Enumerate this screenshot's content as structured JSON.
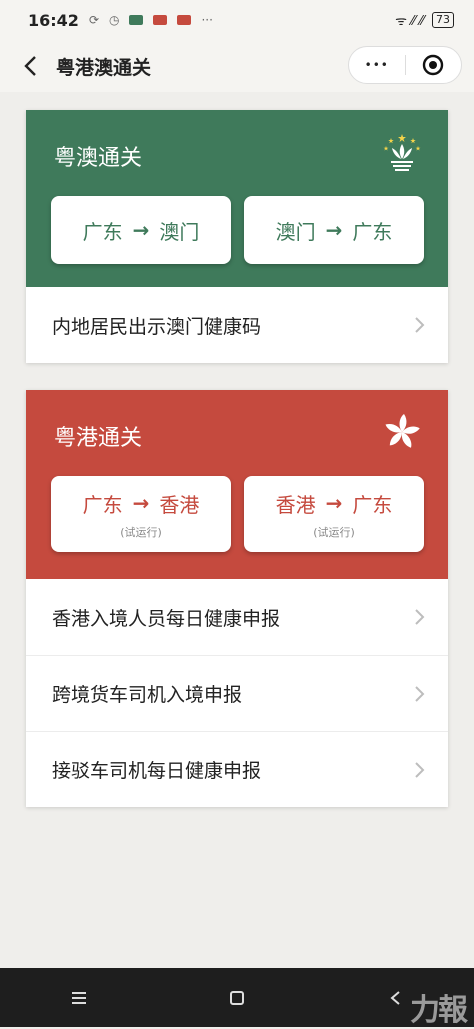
{
  "status": {
    "time": "16:42",
    "dots": "···",
    "battery": "73",
    "signal_text": "ᯤ ⁄⁄ ⁄⁄"
  },
  "header": {
    "title": "粤港澳通关",
    "more_glyph": "•••"
  },
  "macau": {
    "title": "粤澳通关",
    "color": "#3f7a5b",
    "buttons": [
      {
        "from": "广东",
        "arrow": "→",
        "to": "澳门"
      },
      {
        "from": "澳门",
        "arrow": "→",
        "to": "广东"
      }
    ],
    "rows": [
      {
        "label": "内地居民出示澳门健康码"
      }
    ]
  },
  "hongkong": {
    "title": "粤港通关",
    "color": "#c54a3e",
    "buttons": [
      {
        "from": "广东",
        "arrow": "→",
        "to": "香港",
        "note": "(试运行)"
      },
      {
        "from": "香港",
        "arrow": "→",
        "to": "广东",
        "note": "(试运行)"
      }
    ],
    "rows": [
      {
        "label": "香港入境人员每日健康申报"
      },
      {
        "label": "跨境货车司机入境申报"
      },
      {
        "label": "接驳车司机每日健康申报"
      }
    ]
  },
  "watermark": "力報"
}
